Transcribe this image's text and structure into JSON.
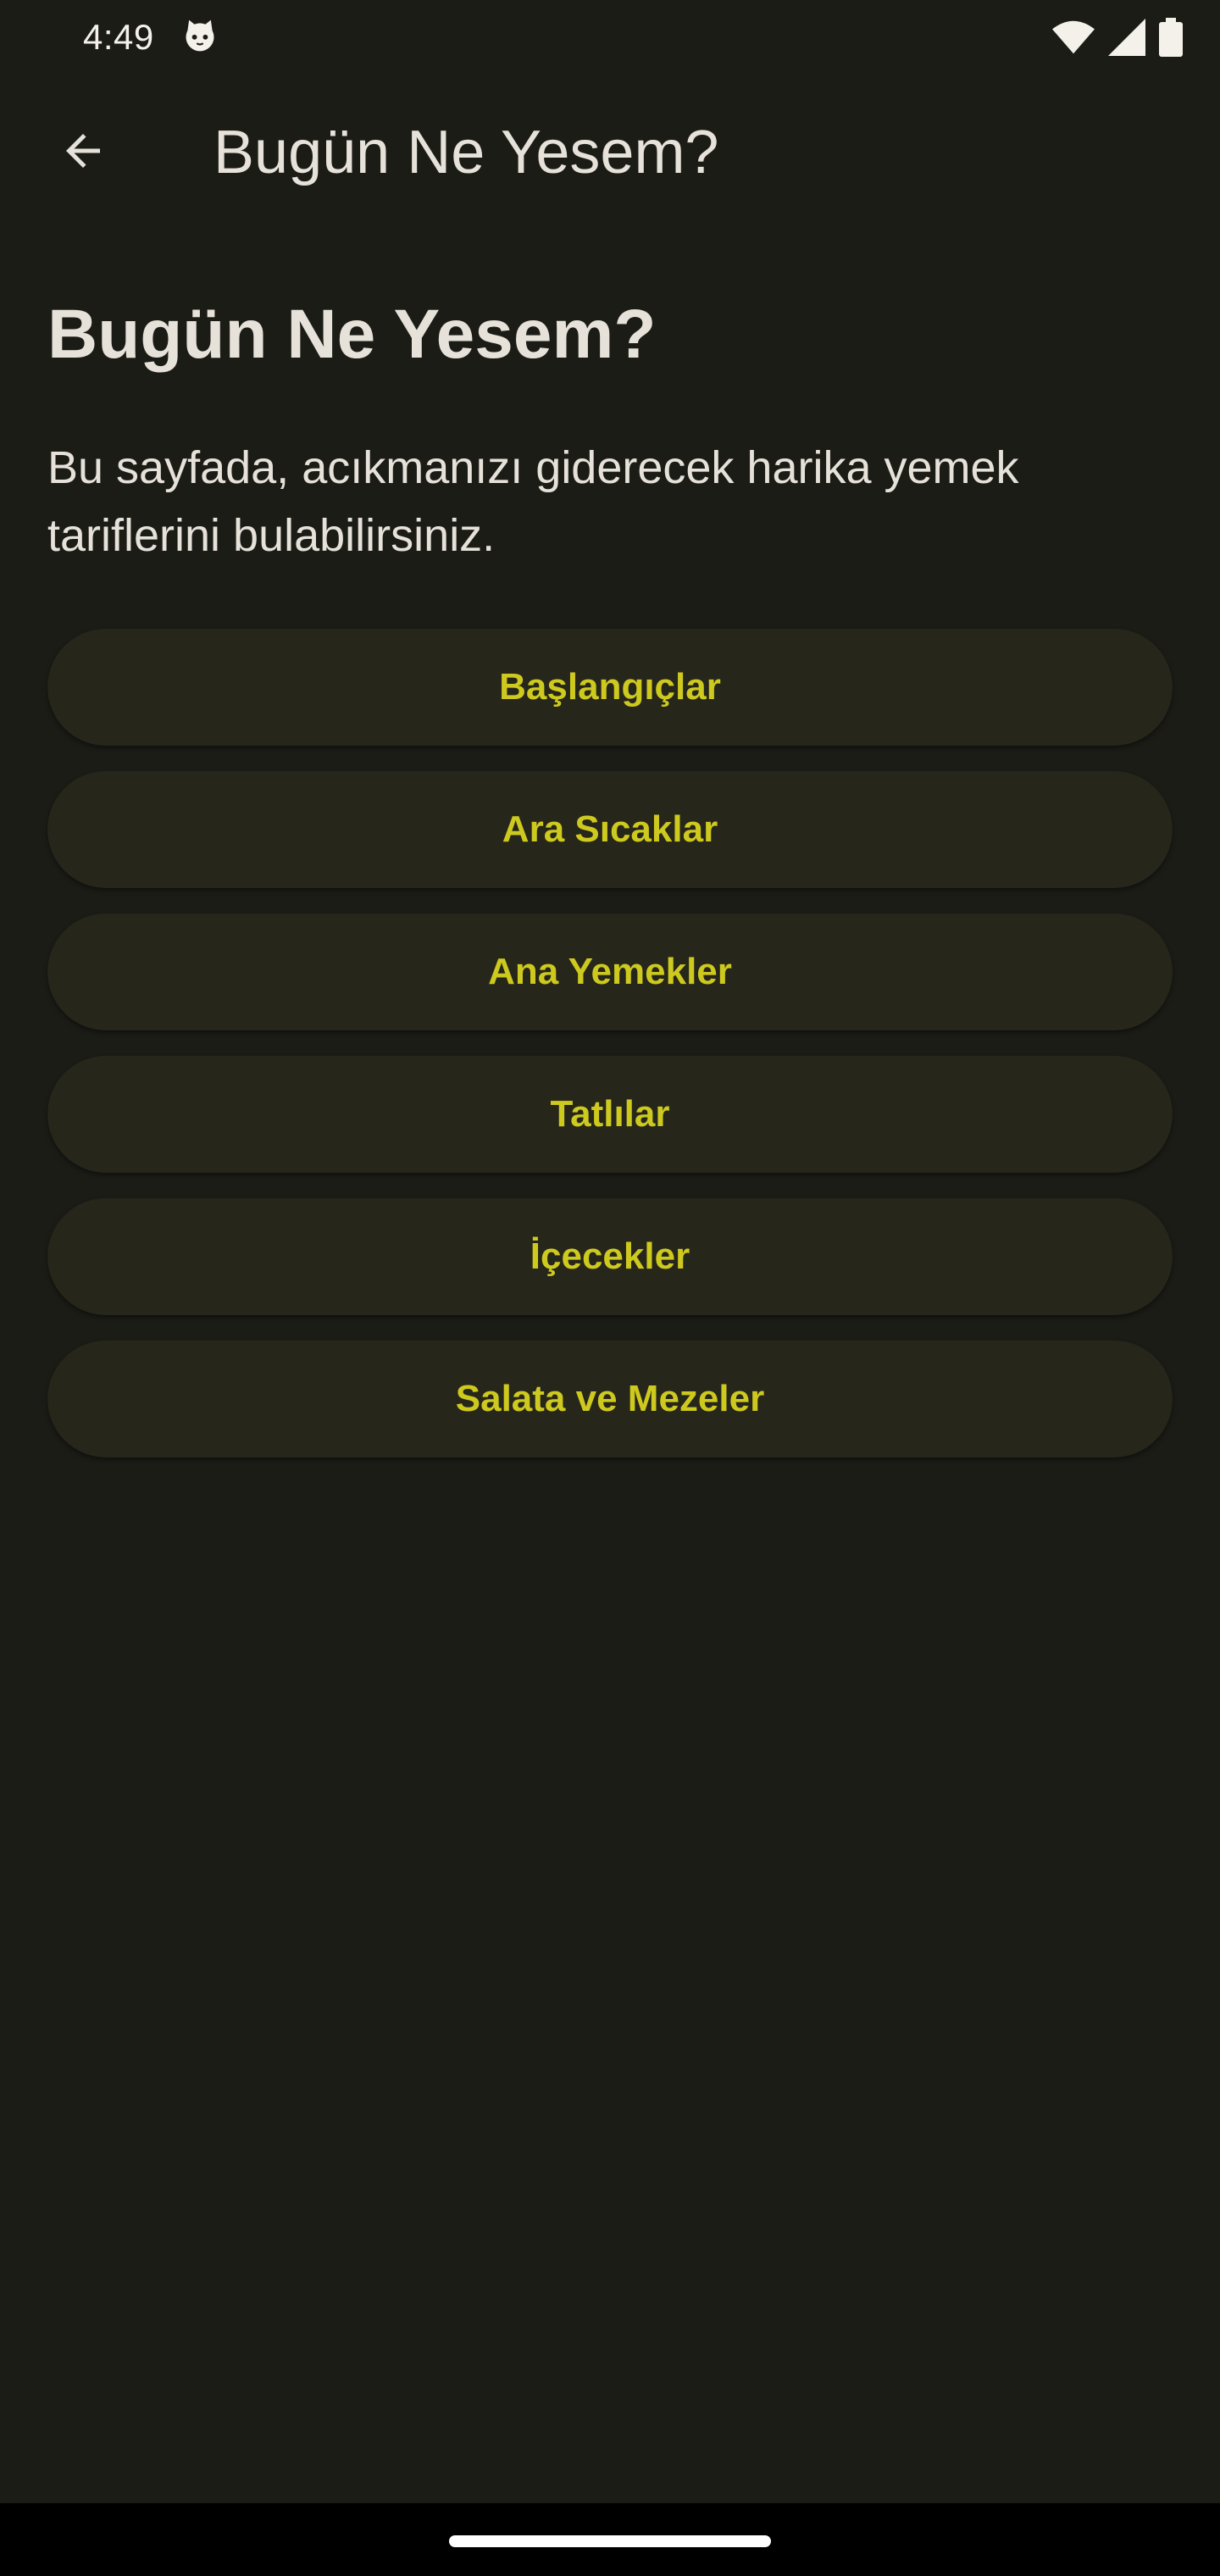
{
  "status_bar": {
    "time": "4:49",
    "icons": [
      "cat-notification-icon",
      "wifi-icon",
      "cellular-signal-icon",
      "battery-icon"
    ]
  },
  "app_bar": {
    "back_icon": "arrow-back-icon",
    "title": "Bugün Ne Yesem?"
  },
  "main": {
    "heading": "Bugün Ne Yesem?",
    "description": "Bu sayfada, acıkmanızı giderecek harika yemek tariflerini bulabilirsiniz.",
    "categories": [
      {
        "label": "Başlangıçlar"
      },
      {
        "label": "Ara Sıcaklar"
      },
      {
        "label": "Ana Yemekler"
      },
      {
        "label": "Tatlılar"
      },
      {
        "label": "İçecekler"
      },
      {
        "label": "Salata ve Mezeler"
      }
    ]
  },
  "colors": {
    "background": "#1c1c17",
    "button_background": "#26261b",
    "button_text": "#cdc91e",
    "text": "#e6e2d9"
  }
}
